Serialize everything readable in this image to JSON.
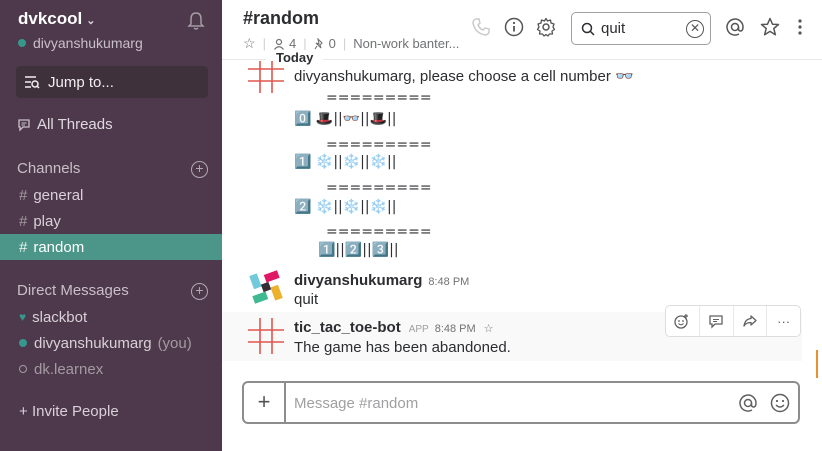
{
  "sidebar": {
    "team_name": "dvkcool",
    "user_name": "divyanshukumarg",
    "jump_to": "Jump to...",
    "all_threads": "All Threads",
    "channels_header": "Channels",
    "channels": [
      "general",
      "play",
      "random"
    ],
    "active_channel": "random",
    "dm_header": "Direct Messages",
    "dms": [
      {
        "name": "slackbot",
        "status": "heart"
      },
      {
        "name": "divyanshukumarg",
        "suffix": "(you)",
        "status": "online"
      },
      {
        "name": "dk.learnex",
        "status": "away"
      }
    ],
    "invite": "Invite People"
  },
  "header": {
    "channel_title": "#random",
    "members": "4",
    "pins": "0",
    "topic": "Non-work banter..."
  },
  "search": {
    "value": "quit"
  },
  "today_label": "Today",
  "messages": {
    "bot_prompt": "divyanshukumarg, please choose a cell number 👓",
    "board": [
      "=========",
      "0️⃣ 🎩||👓||🎩||",
      "=========",
      "1️⃣ ❄️||❄️||❄️||",
      "=========",
      "2️⃣ ❄️||❄️||❄️||",
      "=========",
      "   1️⃣||2️⃣||3️⃣||"
    ],
    "user_sender": "divyanshukumarg",
    "user_time": "8:48 PM",
    "user_text": "quit",
    "bot_sender": "tic_tac_toe-bot",
    "bot_badge": "APP",
    "bot_time": "8:48 PM",
    "bot_text": "The game has been abandoned."
  },
  "composer": {
    "placeholder": "Message #random"
  },
  "colors": {
    "sidebar_bg": "#4d394b",
    "active_channel_bg": "#4c9689",
    "online_green": "#38978d",
    "ttt_red": "#e0564f"
  }
}
